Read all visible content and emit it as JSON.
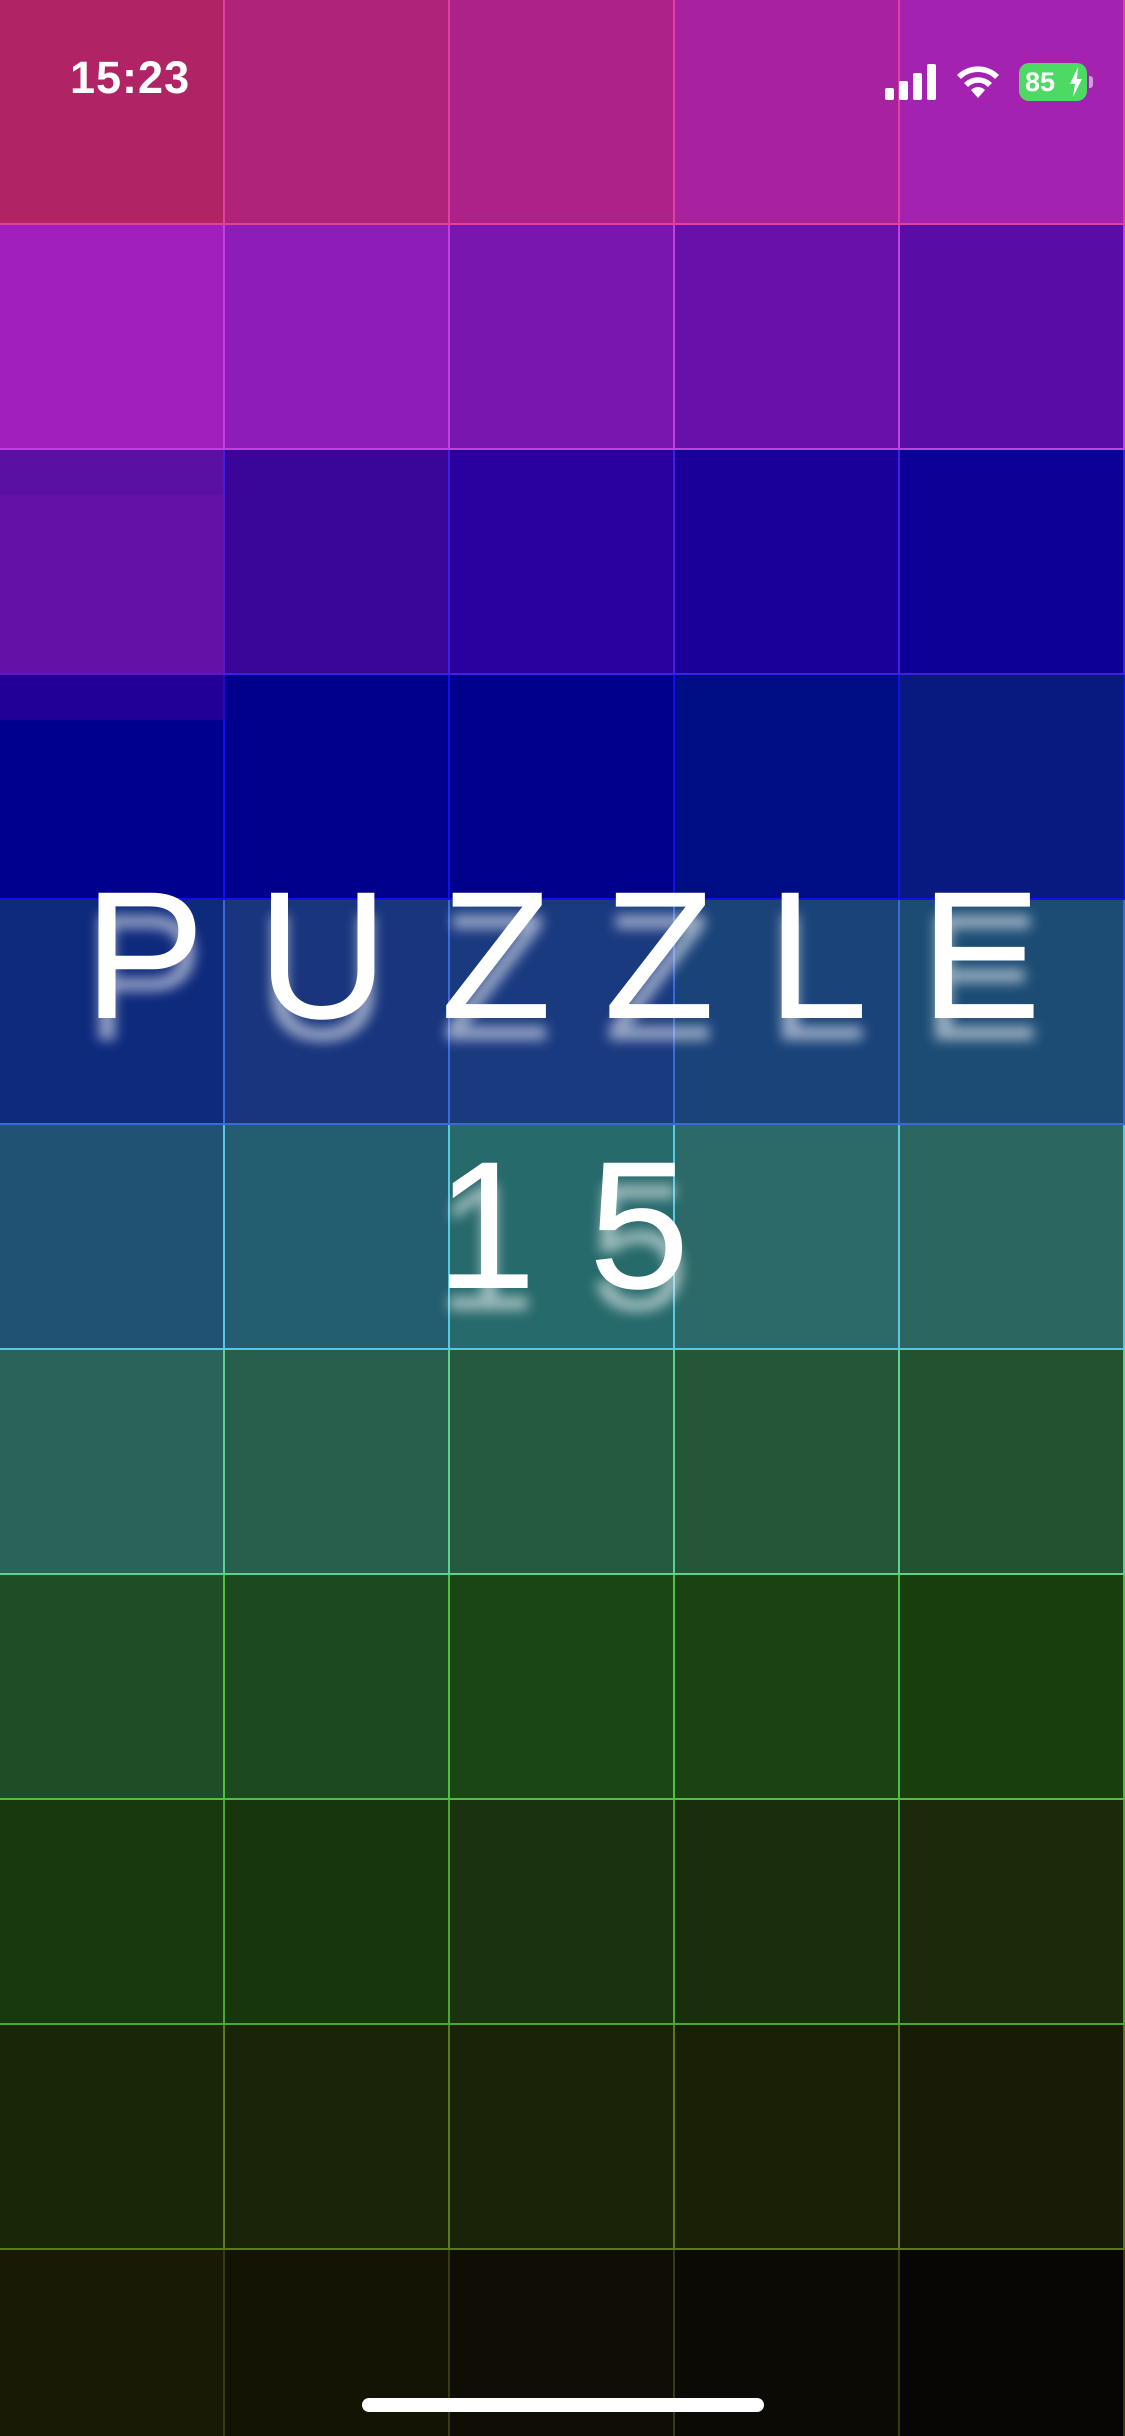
{
  "status_bar": {
    "time": "15:23",
    "battery_level": "85",
    "icons": [
      "cellular-signal-icon",
      "wifi-icon",
      "battery-charging-icon"
    ]
  },
  "title": {
    "line1": "PUZZLE",
    "line2": "15"
  },
  "background_grid": {
    "columns": 5,
    "rows": 11,
    "row_colors": [
      [
        "#b02466",
        "#b0237a",
        "#ad2289",
        "#a822a0",
        "#a322b0"
      ],
      [
        "#a01fbd",
        "#8e1cb7",
        "#7a16b0",
        "#6810aa",
        "#5a0ca6"
      ],
      [
        "#5a10a2",
        "#3a0699",
        "#2a009f",
        "#1a0099",
        "#0c0096"
      ],
      [
        "#00008f",
        "#00008d",
        "#00008d",
        "#000e86",
        "#081a80"
      ],
      [
        "#0e2a7c",
        "#18357d",
        "#1a3a80",
        "#1a437a",
        "#1c4c74"
      ],
      [
        "#205274",
        "#235e70",
        "#276a6c",
        "#2b6a68",
        "#2c6660"
      ],
      [
        "#2a6458",
        "#285e4c",
        "#265a40",
        "#245638",
        "#225230"
      ],
      [
        "#1f4e26",
        "#1c4a1e",
        "#1a4616",
        "#1a4212",
        "#183e0e"
      ],
      [
        "#163a0e",
        "#18360e",
        "#1a320e",
        "#1a2e0c",
        "#1a2a0a"
      ],
      [
        "#1a2608",
        "#1a2408",
        "#1a2208",
        "#1a2006",
        "#181c06"
      ],
      [
        "#181a06",
        "#141404",
        "#100e04",
        "#0c0a04",
        "#080604"
      ]
    ],
    "row_line_colors": [
      "#e040a0",
      "#c040e0",
      "#4020e0",
      "#1010e8",
      "#3a6ad8",
      "#5ac8e0",
      "#60d090",
      "#50c040",
      "#4aa830",
      "#5a7a20",
      "#3a3a10"
    ]
  }
}
